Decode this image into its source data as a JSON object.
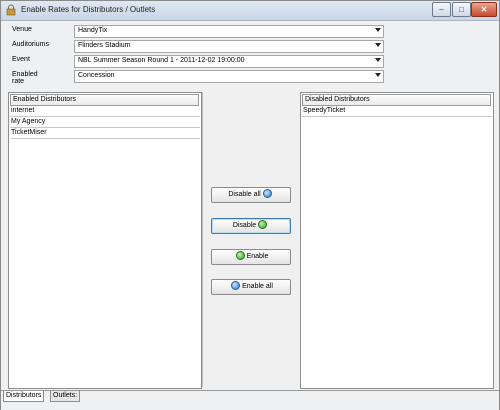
{
  "window": {
    "title": "Enable Rates for Distributors / Outlets"
  },
  "controls": {
    "minimize": "–",
    "maximize": "□",
    "close": "✕"
  },
  "form": {
    "venue": {
      "label": "Venue",
      "value": "HandyTix"
    },
    "auditoriums": {
      "label": "Auditoriums",
      "value": "Flinders Stadium"
    },
    "event": {
      "label": "Event",
      "value": "NBL Summer Season Round 1 - 2011-12-02 19:00:00"
    },
    "enabled_rate": {
      "label": "Enabled rate",
      "value": "Concession"
    }
  },
  "enabled_list": {
    "header": "Enabled Distributors",
    "items": [
      "internet",
      "My Agency",
      "TicketMiser"
    ]
  },
  "disabled_list": {
    "header": "Disabled Distributors",
    "items": [
      "SpeedyTicket"
    ]
  },
  "buttons": {
    "disable_all": "Disable all",
    "disable": "Disable",
    "enable": "Enable",
    "enable_all": "Enable all"
  },
  "tabs": [
    "Distributors",
    "Outlets:"
  ],
  "icons": {
    "app": "lock-icon",
    "disable_all": "refresh-icon",
    "disable": "arrow-right-icon",
    "enable": "arrow-left-icon",
    "enable_all": "refresh-icon"
  },
  "colors": {
    "titlebar": "#c9d6e6",
    "close_button": "#c74a30",
    "icon_blue": "#2c79c9",
    "icon_green": "#2e9b22"
  }
}
